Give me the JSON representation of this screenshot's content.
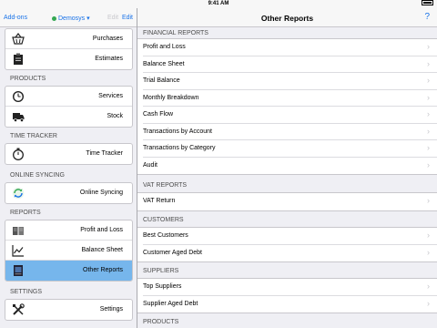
{
  "status_bar": {
    "carrier": "iPad",
    "time": "9:41 AM"
  },
  "left_header": {
    "addons_label": "Add-ons",
    "company_label": "Demosys ▾",
    "ghost_label": "Edit",
    "edit_label": "Edit"
  },
  "left_groups": [
    {
      "label": "",
      "items": [
        {
          "label": "Purchases",
          "icon": "basket-icon"
        },
        {
          "label": "Estimates",
          "icon": "clipboard-icon"
        }
      ]
    },
    {
      "label": "PRODUCTS",
      "items": [
        {
          "label": "Services",
          "icon": "clock-icon"
        },
        {
          "label": "Stock",
          "icon": "truck-icon"
        }
      ]
    },
    {
      "label": "TIME TRACKER",
      "items": [
        {
          "label": "Time Tracker",
          "icon": "stopwatch-icon"
        }
      ]
    },
    {
      "label": "ONLINE SYNCING",
      "items": [
        {
          "label": "Online Syncing",
          "icon": "sync-icon"
        }
      ]
    },
    {
      "label": "REPORTS",
      "items": [
        {
          "label": "Profit and Loss",
          "icon": "book-icon"
        },
        {
          "label": "Balance Sheet",
          "icon": "chart-icon"
        },
        {
          "label": "Other Reports",
          "icon": "document-icon",
          "active": true
        }
      ]
    },
    {
      "label": "SETTINGS",
      "items": [
        {
          "label": "Settings",
          "icon": "tools-icon"
        }
      ]
    }
  ],
  "right_header": {
    "title": "Other Reports",
    "help": "?"
  },
  "right_sections": [
    {
      "label": "FINANCIAL REPORTS",
      "items": [
        "Profit and Loss",
        "Balance Sheet",
        "Trial Balance",
        "Monthly Breakdown",
        "Cash Flow",
        "Transactions by Account",
        "Transactions by Category",
        "Audit"
      ]
    },
    {
      "label": "VAT REPORTS",
      "items": [
        "VAT Return"
      ]
    },
    {
      "label": "CUSTOMERS",
      "items": [
        "Best Customers",
        "Customer Aged Debt"
      ]
    },
    {
      "label": "SUPPLIERS",
      "items": [
        "Top Suppliers",
        "Supplier Aged Debt"
      ]
    },
    {
      "label": "PRODUCTS",
      "items": []
    }
  ],
  "colors": {
    "accent": "#1a73e8",
    "active_row": "#76b6ec",
    "sync_green": "#34a853"
  }
}
